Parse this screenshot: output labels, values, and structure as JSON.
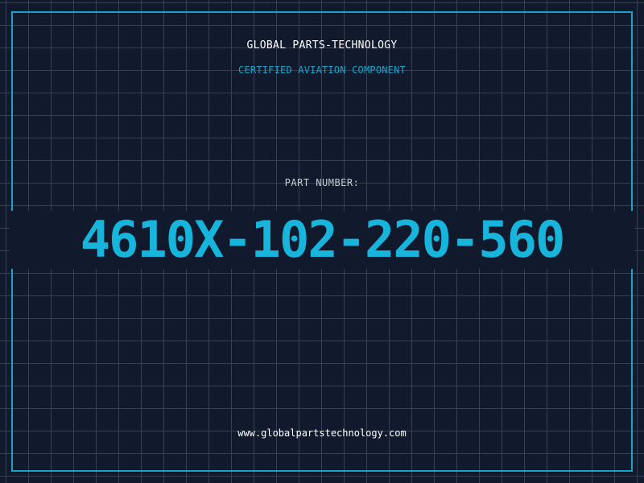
{
  "header": {
    "company": "GLOBAL PARTS-TECHNOLOGY",
    "tagline": "CERTIFIED AVIATION COMPONENT"
  },
  "part": {
    "label": "PART NUMBER:",
    "number": "4610X-102-220-560"
  },
  "footer": {
    "website": "www.globalpartstechnology.com"
  },
  "colors": {
    "background": "#111a2c",
    "grid": "#1d4a60",
    "accent": "#17b4dc",
    "frame": "#1aa3c9"
  }
}
